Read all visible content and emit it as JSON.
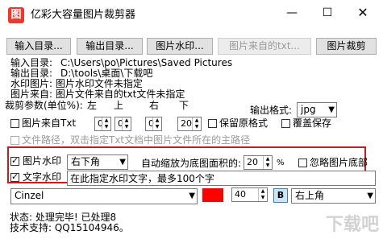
{
  "window": {
    "title": "亿彩大容量图片裁剪器",
    "app_icon_glyph": "图",
    "minimize_icon": "minimize-icon",
    "maximize_icon": "maximize-icon",
    "close_icon": "close-icon"
  },
  "toolbar": {
    "input_dir": "输入目录...",
    "output_dir": "输出目录...",
    "watermark": "图片水印...",
    "from_txt": "图片来自的txt...",
    "crop": "图片裁剪"
  },
  "info": {
    "input_label": "输入目录:",
    "input_value": "C:\\Users\\po\\Pictures\\Saved Pictures",
    "output_label": "输出目录:",
    "output_value": "D:\\tools\\桌面\\下载吧",
    "watermark_line": "水印图片: 图片水印文件未指定",
    "source_line": "图片来自: 图片文件来自的txt文件未指定"
  },
  "crop_params": {
    "label": "裁剪参数(单位%):",
    "left": "左",
    "top": "上",
    "right": "右",
    "bottom": "下",
    "values": [
      "0",
      "0",
      "0",
      "20"
    ]
  },
  "output_format": {
    "label": "输出格式:",
    "value": "jpg"
  },
  "options": {
    "from_txt": "图片来自Txt",
    "keep_format": "保留原格式",
    "overwrite": "覆盖保存",
    "path_hint": "文件路径，双击指定Txt文档中图片文件所在的主路径"
  },
  "watermark_image": {
    "label": "图片水印",
    "position": "右下角",
    "scale_label": "自动缩放为底图面积的:",
    "scale_value": "20",
    "scale_unit": "%",
    "ignore_label": "忽略图片底部"
  },
  "watermark_text": {
    "label": "文字水印",
    "value": "在此指定水印文字，最多100个字"
  },
  "font_row": {
    "font": "Cinzel",
    "color_hex": "#ff0000",
    "size": "40",
    "bold": "B",
    "position": "右上角"
  },
  "status": {
    "line1": "状态: 处理完毕! 已处理8",
    "line2": "技术支持: QQ15104946。"
  },
  "watermark_brand": "下载吧"
}
